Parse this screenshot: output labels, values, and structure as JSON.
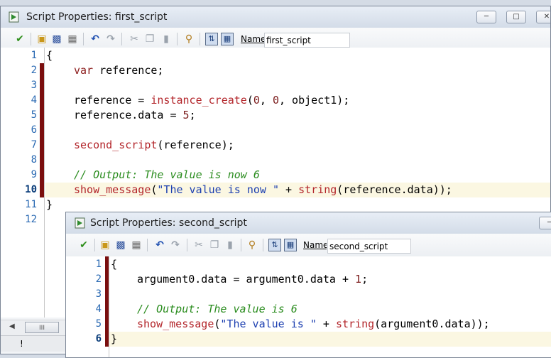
{
  "first_window": {
    "title": "Script Properties: first_script",
    "name_label": "Name",
    "name_value": "first_script",
    "minimize_icon": "minimize-icon",
    "maximize_icon": "maximize-icon",
    "line_numbers": [
      "1",
      "2",
      "3",
      "4",
      "5",
      "6",
      "7",
      "8",
      "9",
      "10",
      "11",
      "12"
    ],
    "current_line": "10",
    "scroll_thumb_label": "III",
    "status_text": "!"
  },
  "second_window": {
    "title": "Script Properties: second_script",
    "name_label": "Name",
    "name_value": "second_script",
    "line_numbers": [
      "1",
      "2",
      "3",
      "4",
      "5",
      "6"
    ],
    "current_line": "6"
  },
  "toolbar_icons": [
    "ok-check-icon",
    "open-icon",
    "save-icon",
    "print-icon",
    "undo-icon",
    "redo-icon",
    "cut-icon",
    "copy-icon",
    "paste-icon",
    "find-icon",
    "code-completion-toggle-icon",
    "check-syntax-toggle-icon"
  ],
  "code1": {
    "l1_brace": "{",
    "l2_kw": "var",
    "l2_rest": " reference;",
    "l4_id": "reference = ",
    "l4_fn": "instance_create",
    "l4_p1": "(",
    "l4_n1": "0",
    "l4_c1": ", ",
    "l4_n2": "0",
    "l4_end": ", object1);",
    "l5_id": "reference.data = ",
    "l5_num": "5",
    "l5_end": ";",
    "l7_fn": "second_script",
    "l7_end": "(reference);",
    "l9_comment": "// Output: The value is now 6",
    "l10_fn": "show_message",
    "l10_p": "(",
    "l10_str": "\"The value is now \"",
    "l10_plus": " + ",
    "l10_fn2": "string",
    "l10_end": "(reference.data));",
    "l11_brace": "}"
  },
  "code2": {
    "l1_brace": "{",
    "l2_id": "argument0.data = argument0.data + ",
    "l2_num": "1",
    "l2_end": ";",
    "l4_comment": "// Output: The value is 6",
    "l5_fn": "show_message",
    "l5_p": "(",
    "l5_str": "\"The value is \"",
    "l5_plus": " + ",
    "l5_fn2": "string",
    "l5_end": "(argument0.data));",
    "l6_brace": "}"
  },
  "colors": {
    "line_number": "#2b6ab3",
    "change_bar": "#7a0e0e",
    "function": "#b3262b",
    "string": "#1c3fb0",
    "comment": "#2a8c1e",
    "current_line_bg": "#fbf7e2"
  }
}
